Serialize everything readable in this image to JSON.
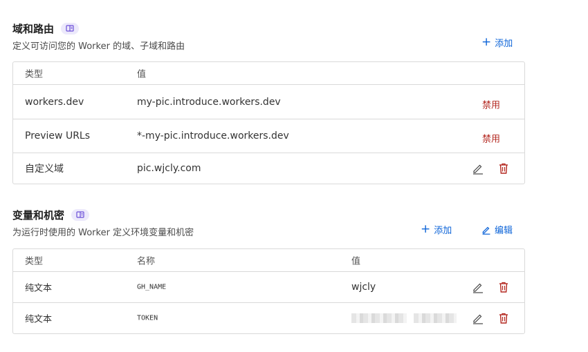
{
  "domains": {
    "title": "域和路由",
    "description": "定义可访问您的 Worker 的域、子域和路由",
    "add_label": "添加",
    "columns": [
      "类型",
      "值"
    ],
    "rows": [
      {
        "type": "workers.dev",
        "value": "my-pic.introduce.workers.dev",
        "action": "禁用"
      },
      {
        "type": "Preview URLs",
        "value": "*-my-pic.introduce.workers.dev",
        "action": "禁用"
      },
      {
        "type": "自定义域",
        "value": "pic.wjcly.com"
      }
    ]
  },
  "variables": {
    "title": "变量和机密",
    "description": "为运行时使用的 Worker 定义环境变量和机密",
    "add_label": "添加",
    "edit_label": "编辑",
    "columns": [
      "类型",
      "名称",
      "值"
    ],
    "rows": [
      {
        "type": "纯文本",
        "name": "GH_NAME",
        "value": "wjcly"
      },
      {
        "type": "纯文本",
        "name": "TOKEN",
        "value_hidden": true
      }
    ]
  },
  "colors": {
    "accent": "#0d64d8",
    "danger": "#b3261e",
    "badge_bg": "#ece9fb",
    "badge_icon": "#6b4fd8"
  },
  "icons": [
    "plus-icon",
    "pencil-icon",
    "trash-icon",
    "book-icon"
  ]
}
